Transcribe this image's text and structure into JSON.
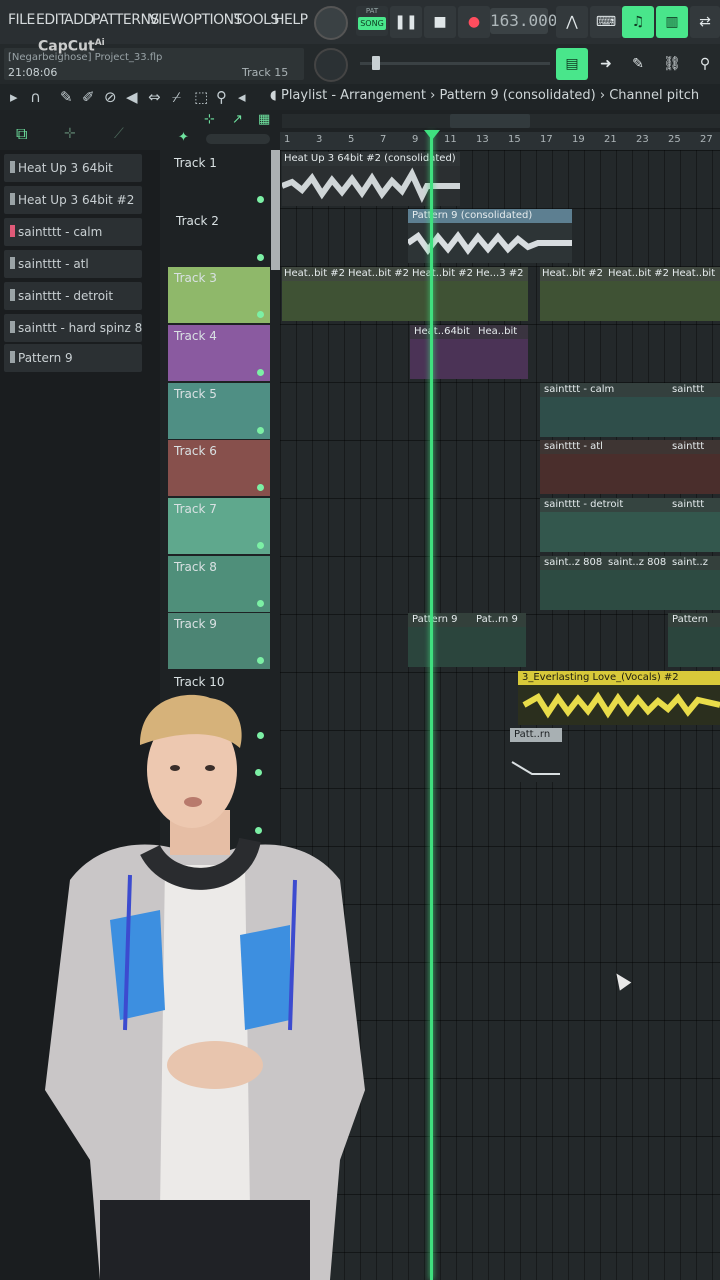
{
  "watermark": "CapCut",
  "watermark_suffix": "Ai",
  "menu": [
    "FILE",
    "EDIT",
    "ADD",
    "PATTERNS",
    "VIEW",
    "OPTIONS",
    "TOOLS",
    "HELP"
  ],
  "transport": {
    "pat_label": "PAT",
    "song_label": "SONG",
    "tempo": "163.000"
  },
  "project": {
    "file": "[Negarbeighose] Project_33.flp",
    "time": "21:08:06",
    "hint": "Track 15"
  },
  "breadcrumb": {
    "parts": [
      "Playlist - Arrangement",
      "Pattern 9 (consolidated)",
      "Channel pitch"
    ],
    "sep": "›"
  },
  "ruler": [
    "1",
    "3",
    "5",
    "7",
    "9",
    "11",
    "13",
    "15",
    "17",
    "19",
    "21",
    "23",
    "25",
    "27"
  ],
  "channels": [
    "Heat Up 3 64bit",
    "Heat Up 3 64bit #2",
    "saintttt - calm",
    "saintttt - atl",
    "saintttt - detroit",
    "sainttt - hard spinz 808",
    "Pattern 9"
  ],
  "tracks": [
    {
      "name": "Track 1",
      "color": "#1e2224"
    },
    {
      "name": "Track 2",
      "color": "#1e2224"
    },
    {
      "name": "Track 3",
      "color": "#8fb86a"
    },
    {
      "name": "Track 4",
      "color": "#8a5aa0"
    },
    {
      "name": "Track 5",
      "color": "#4f8f84"
    },
    {
      "name": "Track 6",
      "color": "#87504c"
    },
    {
      "name": "Track 7",
      "color": "#5fa88d"
    },
    {
      "name": "Track 8",
      "color": "#4f8f7a"
    },
    {
      "name": "Track 9",
      "color": "#4c8574"
    },
    {
      "name": "Track 10",
      "color": "#1e2224"
    }
  ],
  "clips": {
    "c1": "Heat Up 3 64bit #2 (consolidated)",
    "c2": "Pattern 9 (consolidated)",
    "c3a": "Heat..bit #2",
    "c3b": "Heat..bit #2",
    "c3c": "Heat..bit #2",
    "c3d": "He...3 #2",
    "c3e": "Heat..bit #2",
    "c3f": "Heat..bit #2",
    "c3g": "Heat..bit",
    "c4a": "Heat..64bit",
    "c4b": "Hea..bit",
    "c5a": "saintttt - calm",
    "c5b": "sainttt",
    "c6a": "saintttt - atl",
    "c6b": "sainttt",
    "c7a": "saintttt - detroit",
    "c7b": "sainttt",
    "c8a": "saint..z 808",
    "c8b": "saint..z 808",
    "c8c": "saint..z",
    "c9a": "Pattern 9",
    "c9b": "Pat..rn 9",
    "c9c": "Pattern",
    "c10": "3_Everlasting Love_(Vocals) #2",
    "c11": "Patt..rn"
  }
}
